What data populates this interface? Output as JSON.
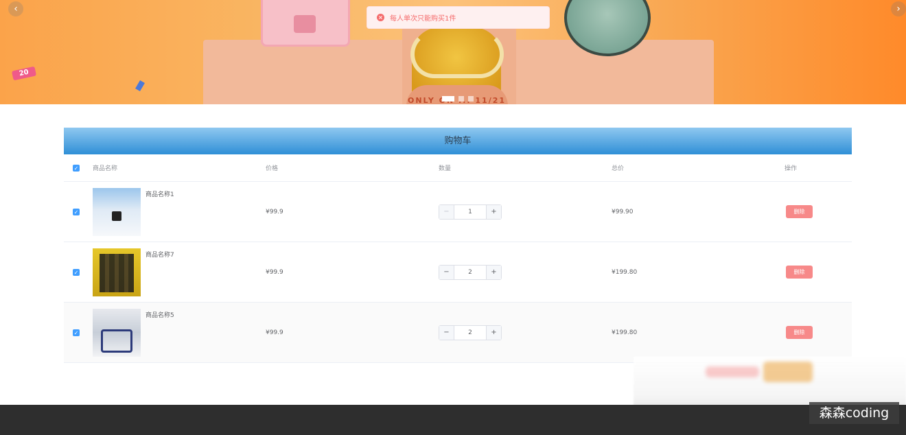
{
  "banner": {
    "prev_label": "‹",
    "next_label": "›",
    "badge_text": "20",
    "ribbon_text": "ONLY ON ... 11/21",
    "slides": [
      "slide-1",
      "slide-2",
      "slide-3"
    ],
    "active_slide": 1
  },
  "toast": {
    "icon": "close-circle-icon",
    "icon_glyph": "×",
    "message": "每人单次只能购买1件",
    "color": "#f56c6c"
  },
  "cart": {
    "title": "购物车",
    "columns": {
      "select_glyph": "✓",
      "name": "商品名称",
      "price": "价格",
      "quantity": "数量",
      "total": "总价",
      "action": "操作"
    },
    "items": [
      {
        "name": "商品名称1",
        "price": "¥99.9",
        "quantity": "1",
        "total": "¥99.90",
        "delete": "删除",
        "checked": "✓"
      },
      {
        "name": "商品名称7",
        "price": "¥99.9",
        "quantity": "2",
        "total": "¥199.80",
        "delete": "删除",
        "checked": "✓"
      },
      {
        "name": "商品名称5",
        "price": "¥99.9",
        "quantity": "2",
        "total": "¥199.80",
        "delete": "删除",
        "checked": "✓"
      }
    ],
    "stepper": {
      "minus": "−",
      "plus": "+"
    },
    "accent": "#409eff",
    "header_color": "#2f8fd6",
    "delete_color": "#f78989"
  },
  "watermark": {
    "text": "森森coding"
  }
}
